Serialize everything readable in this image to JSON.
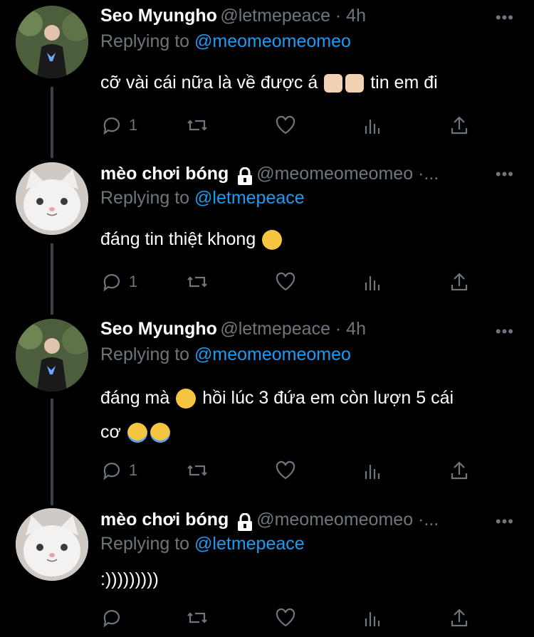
{
  "tweets": [
    {
      "name": "Seo Myungho",
      "handle": "@letmepeace · 4h",
      "replying_label": "Replying to",
      "replying_to": "@meomeomeomeo",
      "text_parts": [
        "cỡ vài cái nữa là về được á",
        "tin em đi"
      ],
      "reply_count": "1",
      "avatar": "person"
    },
    {
      "name": "mèo chơi bóng",
      "handle": "@meomeomeomeo ·...",
      "replying_label": "Replying to",
      "replying_to": "@letmepeace",
      "text_parts": [
        "đáng tin thiệt khong"
      ],
      "reply_count": "1",
      "avatar": "cat",
      "locked": true
    },
    {
      "name": "Seo Myungho",
      "handle": "@letmepeace · 4h",
      "replying_label": "Replying to",
      "replying_to": "@meomeomeomeo",
      "text_parts": [
        "đáng mà",
        "hồi lúc 3 đứa em còn lượn 5 cái",
        "cơ"
      ],
      "reply_count": "1",
      "avatar": "person"
    },
    {
      "name": "mèo chơi bóng",
      "handle": "@meomeomeomeo ·...",
      "replying_label": "Replying to",
      "replying_to": "@letmepeace",
      "text_parts": [
        ":)))))))))"
      ],
      "reply_count": "",
      "avatar": "cat",
      "locked": true
    }
  ],
  "icons": {
    "more": "more-icon",
    "reply": "reply-icon",
    "retweet": "retweet-icon",
    "like": "heart-icon",
    "analytics": "analytics-icon",
    "share": "share-icon"
  },
  "colors": {
    "background": "#000000",
    "muted": "#6e767d",
    "link": "#1d9bf0"
  }
}
